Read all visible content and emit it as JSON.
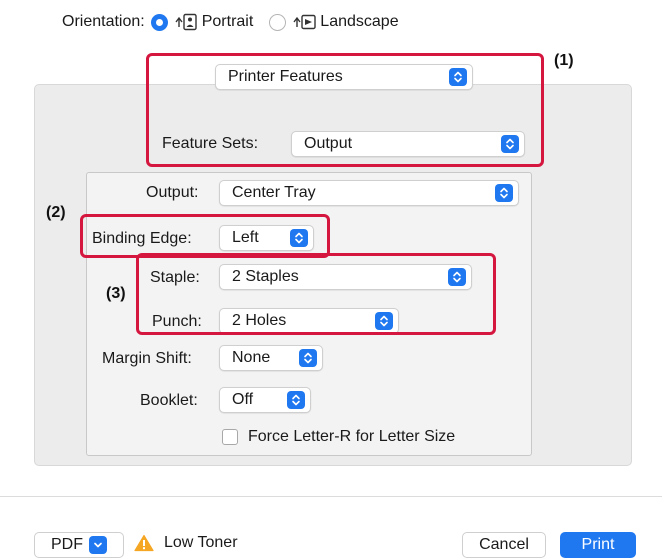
{
  "orientation": {
    "label": "Orientation:",
    "portrait_label": "Portrait",
    "landscape_label": "Landscape",
    "selected": "Portrait"
  },
  "printer_features_menu": {
    "value": "Printer Features"
  },
  "feature_sets": {
    "label": "Feature Sets:",
    "value": "Output"
  },
  "fields": {
    "output": {
      "label": "Output:",
      "value": "Center Tray"
    },
    "binding_edge": {
      "label": "Binding Edge:",
      "value": "Left"
    },
    "staple": {
      "label": "Staple:",
      "value": "2 Staples"
    },
    "punch": {
      "label": "Punch:",
      "value": "2 Holes"
    },
    "margin_shift": {
      "label": "Margin Shift:",
      "value": "None"
    },
    "booklet": {
      "label": "Booklet:",
      "value": "Off"
    }
  },
  "force_letter_r": {
    "label": "Force Letter-R for Letter Size",
    "checked": false
  },
  "annotations": {
    "a1": "(1)",
    "a2": "(2)",
    "a3": "(3)",
    "color": "#d5163f"
  },
  "footer": {
    "pdf_label": "PDF",
    "warning_label": "Low Toner",
    "cancel_label": "Cancel",
    "print_label": "Print"
  },
  "colors": {
    "accent": "#1f78f0",
    "warning": "#f5a623",
    "annotation": "#d5163f"
  },
  "icons": {
    "radio_selected": "radio-selected-icon",
    "radio_unselected": "radio-unselected-icon",
    "portrait": "portrait-orientation-icon",
    "landscape": "landscape-orientation-icon",
    "popup_chevron": "up-down-chevron-icon",
    "pdf_chevron": "chevron-down-icon",
    "warning": "warning-triangle-icon"
  }
}
